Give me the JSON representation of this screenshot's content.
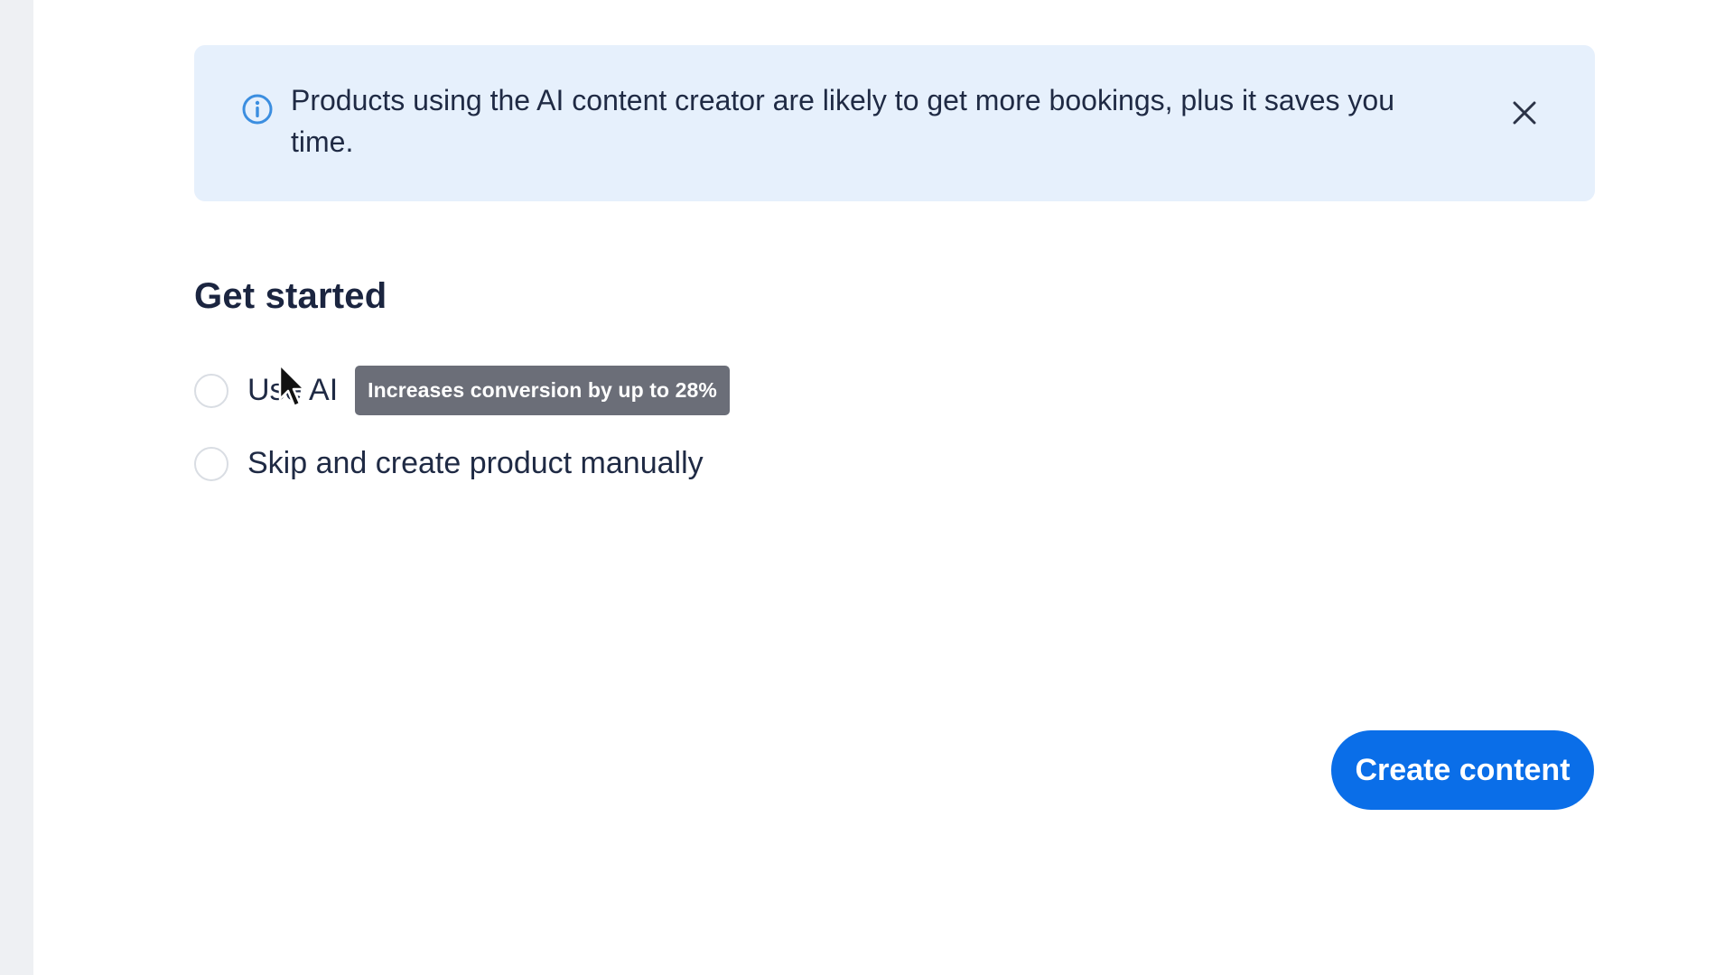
{
  "banner": {
    "message": "Products using the AI content creator are likely to get more bookings, plus it saves you time.",
    "info_icon": "info-circle-icon",
    "close_icon": "close-icon",
    "accent_color": "#3b8ee0"
  },
  "get_started": {
    "title": "Get started",
    "options": [
      {
        "label": "Use AI",
        "badge": "Increases conversion by up to 28%",
        "selected": false
      },
      {
        "label": "Skip and create product manually",
        "selected": false
      }
    ]
  },
  "actions": {
    "create_label": "Create content",
    "primary_color": "#0a6ee8"
  },
  "cursor": {
    "icon": "arrow-cursor-icon"
  }
}
